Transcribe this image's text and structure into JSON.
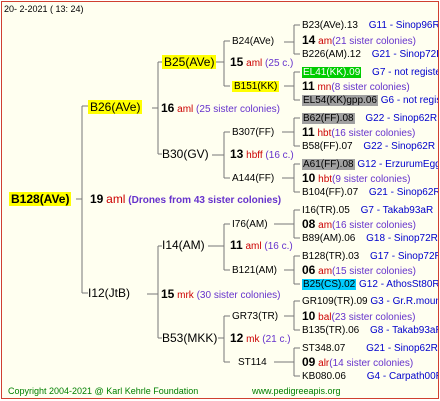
{
  "header": {
    "year_range": "20-   2-2021 (  13:  24)"
  },
  "root": {
    "id": "B128(AVe)",
    "num": "19",
    "type": "aml",
    "colonies": "(Drones from 43 sister colonies)"
  },
  "gen1": {
    "sire": {
      "id": "B26(AVe)",
      "num": "16",
      "type": "aml",
      "colonies": "(25 sister colonies)"
    },
    "dam": {
      "id": "I12(JtB)",
      "num": "15",
      "type": "mrk",
      "colonies": "(30 sister colonies)"
    }
  },
  "gen2": {
    "b25": {
      "id": "B25(AVe)",
      "num": "15",
      "type": "aml",
      "colonies": "(25 c.)"
    },
    "b30": {
      "id": "B30(GV)",
      "num": "13",
      "type": "hbff",
      "colonies": "(16 c.)"
    },
    "i14": {
      "id": "I14(AM)",
      "num": "11",
      "type": "aml",
      "colonies": "(16 c.)"
    },
    "b53": {
      "id": "B53(MKK)",
      "num": "12",
      "type": "mk",
      "colonies": "(21 c.)"
    }
  },
  "gen3": {
    "b24": {
      "id": "B24(AVe)",
      "num": "14",
      "type": "am",
      "colonies": "(21 sister colonies)"
    },
    "b151": {
      "id": "B151(KK)",
      "num": "11",
      "type": "mn",
      "colonies": "(8 sister colonies)"
    },
    "b307": {
      "id": "B307(FF)",
      "num": "11",
      "type": "hbt",
      "colonies": "(16 sister colonies)"
    },
    "a144": {
      "id": "A144(FF)",
      "num": "10",
      "type": "hbt",
      "colonies": "(9 sister colonies)"
    },
    "i76": {
      "id": "I76(AM)",
      "num": "08",
      "type": "am",
      "colonies": "(16 sister colonies)"
    },
    "b121": {
      "id": "B121(AM)",
      "num": "06",
      "type": "am",
      "colonies": "(15 sister colonies)"
    },
    "gr73": {
      "id": "GR73(TR)",
      "num": "10",
      "type": "bal",
      "colonies": "(23 sister colonies)"
    },
    "st114": {
      "id": "ST114",
      "num": "09",
      "type": "alr",
      "colonies": "(14 sister colonies)"
    }
  },
  "gen4": [
    {
      "id": "B23(AVe).13",
      "code": "G11 - Sinop96R"
    },
    {
      "id": "B226(AM).12",
      "code": "G21 - Sinop72R"
    },
    {
      "id": "EL41(KK).09",
      "code": "G7 - not registe"
    },
    {
      "id": "EL54(KK)gpp.06",
      "code": "G6 - not registe"
    },
    {
      "id": "B62(FF).08",
      "code": "G22 - Sinop62R"
    },
    {
      "id": "B58(FF).07",
      "code": "G22 - Sinop62R"
    },
    {
      "id": "A61(FF).08",
      "code": "G12 - ErzurumEgg8"
    },
    {
      "id": "B104(FF).07",
      "code": "G21 - Sinop62R"
    },
    {
      "id": "I16(TR).05",
      "code": "G7 - Takab93aR"
    },
    {
      "id": "B89(AM).06",
      "code": "G18 - Sinop72R"
    },
    {
      "id": "B128(TR).03",
      "code": "G17 - Sinop72R"
    },
    {
      "id": "B25(CS).02",
      "code": "G12 - AthosSt80R"
    },
    {
      "id": "GR109(TR).09",
      "code": "G3 - Gr.R.mounta"
    },
    {
      "id": "B135(TR).06",
      "code": "G8 - Takab93aR"
    },
    {
      "id": "ST348.07",
      "code": "G21 - Sinop62R"
    },
    {
      "id": "KB080.06",
      "code": "G4 - Carpath00R"
    }
  ],
  "footer": {
    "copyright": "Copyright 2004-2021 @ Karl Kehrle Foundation",
    "url": "www.pedigreeapis.org"
  },
  "colors": {
    "highlight": "#ffff00",
    "queen_green": "#00cc00",
    "queen_gray": "#a0a0a0",
    "queen_cyan": "#00ccff",
    "frame": "#d04030"
  }
}
